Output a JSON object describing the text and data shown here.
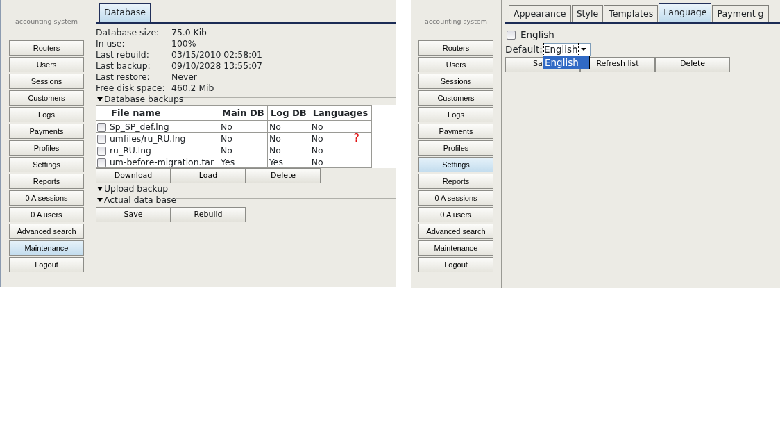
{
  "panels": [
    {
      "kind": "database",
      "brand": "accounting system",
      "menu": [
        {
          "label": "Routers",
          "selected": false
        },
        {
          "label": "Users",
          "selected": false
        },
        {
          "label": "Sessions",
          "selected": false
        },
        {
          "label": "Customers",
          "selected": false
        },
        {
          "label": "Logs",
          "selected": false
        },
        {
          "label": "Payments",
          "selected": false
        },
        {
          "label": "Profiles",
          "selected": false
        },
        {
          "label": "Settings",
          "selected": false
        },
        {
          "label": "Reports",
          "selected": false
        },
        {
          "label": "0 A sessions",
          "selected": false
        },
        {
          "label": "0 A users",
          "selected": false
        },
        {
          "label": "Advanced search",
          "selected": false
        },
        {
          "label": "Maintenance",
          "selected": true
        },
        {
          "label": "Logout",
          "selected": false
        }
      ],
      "tabs": [
        {
          "label": "Database",
          "selected": true
        }
      ],
      "stats": [
        {
          "label": "Database size:",
          "value": "75.0 Kib"
        },
        {
          "label": "In use:",
          "value": "100%"
        },
        {
          "label": "Last rebuild:",
          "value": "03/15/2010 02:58:01"
        },
        {
          "label": "Last backup:",
          "value": "09/10/2028 13:55:07"
        },
        {
          "label": "Last restore:",
          "value": "Never"
        },
        {
          "label": "Free disk space:",
          "value": "460.2 Mib"
        }
      ],
      "sections": [
        {
          "title": "Database backups",
          "expanded": true,
          "columns": [
            "File name",
            "Main DB",
            "Log DB",
            "Languages"
          ],
          "rows": [
            {
              "checked": false,
              "cells": [
                "Sp_SP_def.lng",
                "No",
                "No",
                "No"
              ]
            },
            {
              "checked": false,
              "cells": [
                "umfiles/ru_RU.lng",
                "No",
                "No",
                "No"
              ],
              "note": "?"
            },
            {
              "checked": false,
              "cells": [
                "ru_RU.lng",
                "No",
                "No",
                "No"
              ]
            },
            {
              "checked": false,
              "cells": [
                "um-before-migration.tar",
                "Yes",
                "Yes",
                "No"
              ]
            }
          ],
          "buttons": [
            "Download",
            "Load",
            "Delete"
          ]
        },
        {
          "title": "Upload backup",
          "expanded": true
        },
        {
          "title": "Actual data base",
          "expanded": true,
          "buttons": [
            "Save",
            "Rebuild"
          ]
        }
      ]
    },
    {
      "kind": "language",
      "brand": "accounting system",
      "menu": [
        {
          "label": "Routers",
          "selected": false
        },
        {
          "label": "Users",
          "selected": false
        },
        {
          "label": "Sessions",
          "selected": false
        },
        {
          "label": "Customers",
          "selected": false
        },
        {
          "label": "Logs",
          "selected": false
        },
        {
          "label": "Payments",
          "selected": false
        },
        {
          "label": "Profiles",
          "selected": false
        },
        {
          "label": "Settings",
          "selected": true
        },
        {
          "label": "Reports",
          "selected": false
        },
        {
          "label": "0 A sessions",
          "selected": false
        },
        {
          "label": "0 A users",
          "selected": false
        },
        {
          "label": "Advanced search",
          "selected": false
        },
        {
          "label": "Maintenance",
          "selected": false
        },
        {
          "label": "Logout",
          "selected": false
        }
      ],
      "tabs": [
        {
          "label": "Appearance",
          "selected": false
        },
        {
          "label": "Style",
          "selected": false
        },
        {
          "label": "Templates",
          "selected": false
        },
        {
          "label": "Language",
          "selected": true
        },
        {
          "label": "Payment g",
          "selected": false
        }
      ],
      "languages": [
        {
          "label": "English",
          "checked": false
        }
      ],
      "default": {
        "label": "Default:",
        "value": "English"
      },
      "dropdown": [
        {
          "label": "English",
          "selected": true
        }
      ],
      "buttons": [
        "Sa",
        "Refresh list",
        "Delete"
      ]
    }
  ]
}
